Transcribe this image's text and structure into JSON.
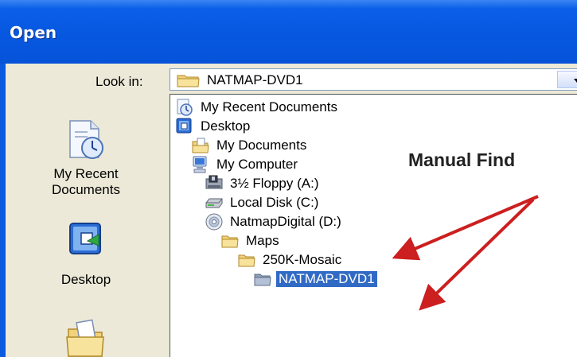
{
  "window": {
    "title": "Open"
  },
  "lookin": {
    "label": "Look in:",
    "value": "NATMAP-DVD1"
  },
  "places": [
    {
      "label_line1": "My Recent",
      "label_line2": "Documents",
      "icon": "recent-documents-icon"
    },
    {
      "label_line1": "Desktop",
      "label_line2": "",
      "icon": "desktop-icon"
    },
    {
      "label_line1": "",
      "label_line2": "",
      "icon": "my-documents-icon"
    }
  ],
  "dropdown": {
    "items": [
      {
        "label": "My Recent Documents",
        "icon": "recent-documents-icon"
      },
      {
        "label": "Desktop",
        "icon": "desktop-icon"
      },
      {
        "label": "My Documents",
        "icon": "my-documents-icon"
      },
      {
        "label": "My Computer",
        "icon": "my-computer-icon"
      },
      {
        "label": "3½ Floppy (A:)",
        "icon": "floppy-icon"
      },
      {
        "label": "Local Disk (C:)",
        "icon": "hard-disk-icon"
      },
      {
        "label": "NatmapDigital (D:)",
        "icon": "cd-drive-icon"
      },
      {
        "label": "Maps",
        "icon": "folder-icon"
      },
      {
        "label": "250K-Mosaic",
        "icon": "folder-icon"
      },
      {
        "label": "NATMAP-DVD1",
        "icon": "folder-icon",
        "selected": true
      }
    ],
    "selection_color": "#316ac5"
  },
  "annotation": {
    "text": "Manual Find",
    "arrow_color": "#cc1f1f"
  },
  "colors": {
    "titlebar": "#0757e0",
    "client": "#ece9d8",
    "folder": "#f2d27a"
  }
}
